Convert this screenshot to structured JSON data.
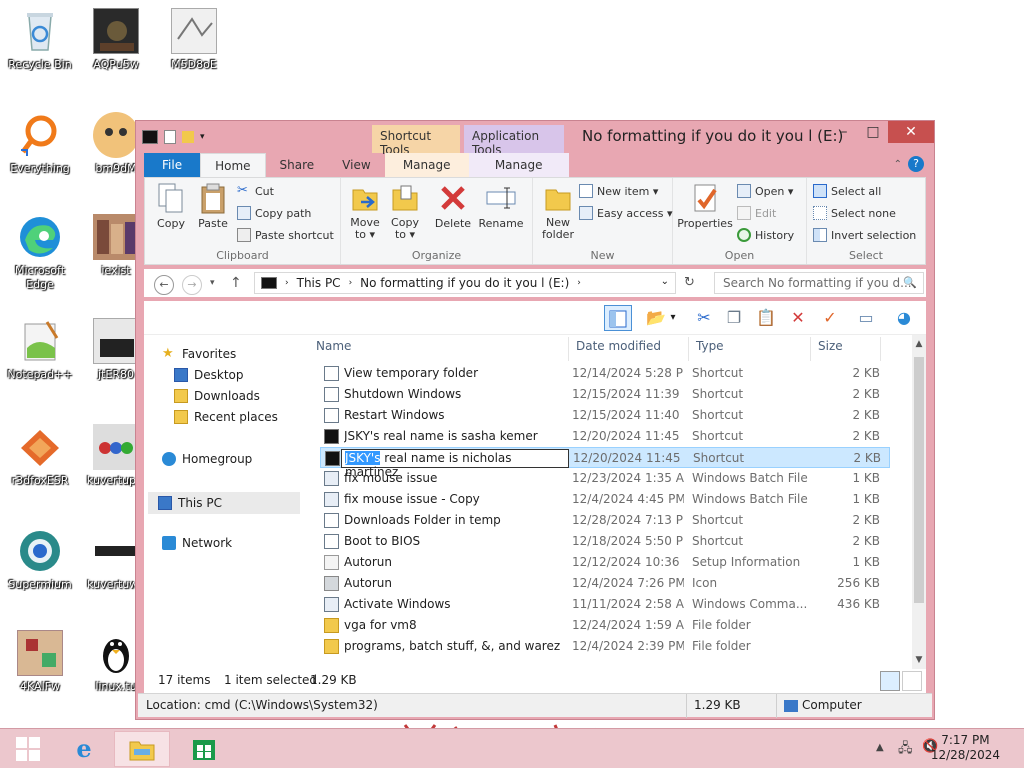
{
  "desktop": {
    "icons": [
      {
        "label": "Recycle Bin",
        "icon": "recycle-bin-icon"
      },
      {
        "label": "AQPu5w",
        "icon": "image-thumbnail-icon"
      },
      {
        "label": "M5D8oE",
        "icon": "image-thumbnail-icon"
      },
      {
        "label": "Everything",
        "icon": "everything-search-icon"
      },
      {
        "label": "bm9dM",
        "icon": "image-thumbnail-icon"
      },
      {
        "label": "Microsoft Edge",
        "icon": "edge-icon"
      },
      {
        "label": "iexist",
        "icon": "image-thumbnail-icon"
      },
      {
        "label": "Notepad++",
        "icon": "notepad-plus-plus-icon"
      },
      {
        "label": "jtER80",
        "icon": "image-thumbnail-icon"
      },
      {
        "label": "r3dfoxESR",
        "icon": "r3dfox-browser-icon"
      },
      {
        "label": "kuvertupic",
        "icon": "image-thumbnail-icon"
      },
      {
        "label": "Supermium",
        "icon": "supermium-browser-icon"
      },
      {
        "label": "kuvertuwa",
        "icon": "image-thumbnail-icon"
      },
      {
        "label": "4KAlFw",
        "icon": "image-thumbnail-icon"
      },
      {
        "label": "linux.tu",
        "icon": "linux-penguin-icon"
      }
    ]
  },
  "window": {
    "title": "No formatting if you do it you l (E:)",
    "context_tabs": {
      "shortcut_tools": "Shortcut Tools",
      "application_tools": "Application Tools"
    },
    "controls": {
      "minimize": "–",
      "maximize": "□",
      "close": "✕"
    }
  },
  "tabs": {
    "file": "File",
    "home": "Home",
    "share": "Share",
    "view": "View",
    "manage1": "Manage",
    "manage2": "Manage"
  },
  "ribbon": {
    "clipboard": {
      "name": "Clipboard",
      "copy": "Copy",
      "paste": "Paste",
      "cut": "Cut",
      "copy_path": "Copy path",
      "paste_shortcut": "Paste shortcut"
    },
    "organize": {
      "name": "Organize",
      "move_to": "Move to ▾",
      "copy_to": "Copy to ▾",
      "delete": "Delete",
      "rename": "Rename"
    },
    "new": {
      "name": "New",
      "new_folder": "New folder",
      "new_item": "New item ▾",
      "easy_access": "Easy access ▾"
    },
    "open": {
      "name": "Open",
      "properties": "Properties",
      "open": "Open ▾",
      "edit": "Edit",
      "history": "History"
    },
    "select": {
      "name": "Select",
      "select_all": "Select all",
      "select_none": "Select none",
      "invert": "Invert selection"
    }
  },
  "address": {
    "crumb1": "This PC",
    "crumb2": "No formatting if you do it you l (E:)",
    "search_placeholder": "Search No formatting if you d..."
  },
  "nav": {
    "favorites": "Favorites",
    "desktop": "Desktop",
    "downloads": "Downloads",
    "recent": "Recent places",
    "homegroup": "Homegroup",
    "thispc": "This PC",
    "network": "Network"
  },
  "columns": {
    "name": "Name",
    "date": "Date modified",
    "type": "Type",
    "size": "Size"
  },
  "files": [
    {
      "name": "View temporary folder",
      "date": "12/14/2024 5:28 PM",
      "type": "Shortcut",
      "size": "2 KB",
      "icon": "shortcut-icon"
    },
    {
      "name": "Shutdown Windows",
      "date": "12/15/2024 11:39 ...",
      "type": "Shortcut",
      "size": "2 KB",
      "icon": "shortcut-icon"
    },
    {
      "name": "Restart Windows",
      "date": "12/15/2024 11:40 ...",
      "type": "Shortcut",
      "size": "2 KB",
      "icon": "shortcut-icon"
    },
    {
      "name": "JSKY's real name is sasha kemer",
      "date": "12/20/2024 11:45 ...",
      "type": "Shortcut",
      "size": "2 KB",
      "icon": "cmd-shortcut-icon"
    },
    {
      "name": "JSKY's real name is nicholas martinez",
      "date": "12/20/2024 11:45 ...",
      "type": "Shortcut",
      "size": "2 KB",
      "icon": "cmd-shortcut-icon",
      "rename_highlight": "JSKY's",
      "rename_rest": " real name is nicholas martinez"
    },
    {
      "name": "fix mouse issue",
      "date": "12/23/2024 1:35 AM",
      "type": "Windows Batch File",
      "size": "1 KB",
      "icon": "batch-file-icon"
    },
    {
      "name": "fix mouse issue - Copy",
      "date": "12/4/2024 4:45 PM",
      "type": "Windows Batch File",
      "size": "1 KB",
      "icon": "batch-file-icon"
    },
    {
      "name": "Downloads Folder in temp",
      "date": "12/28/2024 7:13 PM",
      "type": "Shortcut",
      "size": "2 KB",
      "icon": "shortcut-icon"
    },
    {
      "name": "Boot to BIOS",
      "date": "12/18/2024 5:50 PM",
      "type": "Shortcut",
      "size": "2 KB",
      "icon": "shortcut-icon"
    },
    {
      "name": "Autorun",
      "date": "12/12/2024 10:36 ...",
      "type": "Setup Information",
      "size": "1 KB",
      "icon": "setup-info-icon"
    },
    {
      "name": "Autorun",
      "date": "12/4/2024 7:26 PM",
      "type": "Icon",
      "size": "256 KB",
      "icon": "icon-file-icon"
    },
    {
      "name": "Activate Windows",
      "date": "11/11/2024 2:58 AM",
      "type": "Windows Comma...",
      "size": "436 KB",
      "icon": "command-script-icon"
    },
    {
      "name": "vga for vm8",
      "date": "12/24/2024 1:59 AM",
      "type": "File folder",
      "size": "",
      "icon": "folder-icon"
    },
    {
      "name": "programs, batch stuff, &, and warez",
      "date": "12/4/2024 2:39 PM",
      "type": "File folder",
      "size": "",
      "icon": "folder-icon"
    }
  ],
  "status": {
    "items": "17 items",
    "selected": "1 item selected",
    "size": "1.29 KB"
  },
  "location": {
    "path": "Location: cmd (C:\\Windows\\System32)",
    "size": "1.29 KB",
    "zone": "Computer"
  },
  "taskbar": {
    "time": "7:17 PM",
    "date": "12/28/2024"
  },
  "colors": {
    "frame": "#e8a7b2",
    "close": "#c7504f",
    "accent": "#1979ca",
    "selection": "#cce8ff"
  }
}
